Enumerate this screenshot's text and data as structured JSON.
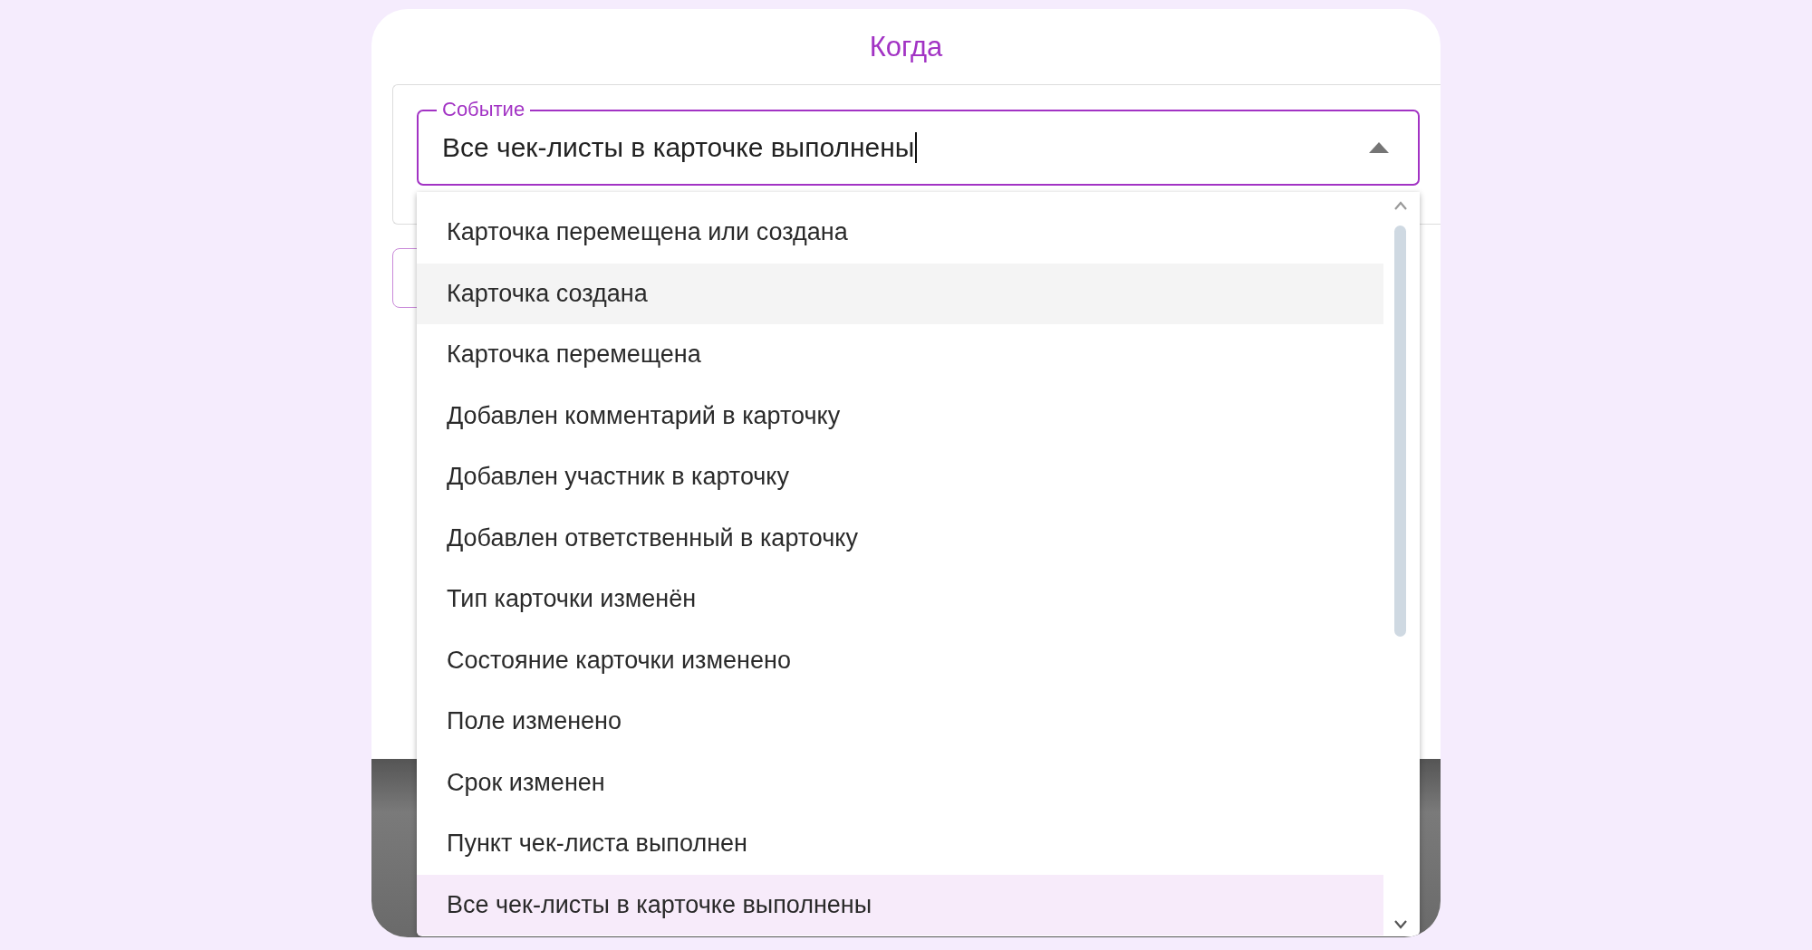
{
  "title": "Когда",
  "event_field": {
    "label": "Событие",
    "value": "Все чек-листы в карточке выполнены",
    "expanded": true
  },
  "options": [
    {
      "label": "Карточка перемещена или создана",
      "highlighted": false,
      "selected": false
    },
    {
      "label": "Карточка создана",
      "highlighted": true,
      "selected": false
    },
    {
      "label": "Карточка перемещена",
      "highlighted": false,
      "selected": false
    },
    {
      "label": "Добавлен комментарий в карточку",
      "highlighted": false,
      "selected": false
    },
    {
      "label": "Добавлен участник в карточку",
      "highlighted": false,
      "selected": false
    },
    {
      "label": "Добавлен ответственный в карточку",
      "highlighted": false,
      "selected": false
    },
    {
      "label": "Тип карточки изменён",
      "highlighted": false,
      "selected": false
    },
    {
      "label": "Состояние карточки изменено",
      "highlighted": false,
      "selected": false
    },
    {
      "label": "Поле изменено",
      "highlighted": false,
      "selected": false
    },
    {
      "label": "Срок изменен",
      "highlighted": false,
      "selected": false
    },
    {
      "label": "Пункт чек-листа выполнен",
      "highlighted": false,
      "selected": false
    },
    {
      "label": "Все чек-листы в карточке выполнены",
      "highlighted": false,
      "selected": true
    }
  ]
}
